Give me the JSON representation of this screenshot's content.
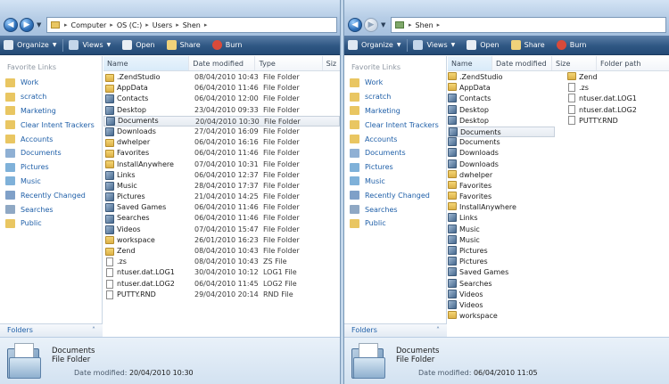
{
  "left": {
    "breadcrumb": [
      "Computer",
      "OS (C:)",
      "Users",
      "Shen"
    ],
    "toolbar": {
      "organize": "Organize",
      "views": "Views",
      "open": "Open",
      "share": "Share",
      "burn": "Burn"
    },
    "favorites_header": "Favorite Links",
    "favorites": [
      "Work",
      "scratch",
      "Marketing",
      "Clear Intent Trackers",
      "Accounts",
      "Documents",
      "Pictures",
      "Music",
      "Recently Changed",
      "Searches",
      "Public"
    ],
    "folders_label": "Folders",
    "columns": [
      "Name",
      "Date modified",
      "Type",
      "Siz"
    ],
    "rows": [
      {
        "name": ".ZendStudio",
        "date": "08/04/2010 10:43",
        "type": "File Folder",
        "icon": "folder"
      },
      {
        "name": "AppData",
        "date": "06/04/2010 11:46",
        "type": "File Folder",
        "icon": "folder"
      },
      {
        "name": "Contacts",
        "date": "06/04/2010 12:00",
        "type": "File Folder",
        "icon": "sys"
      },
      {
        "name": "Desktop",
        "date": "23/04/2010 09:33",
        "type": "File Folder",
        "icon": "sys"
      },
      {
        "name": "Documents",
        "date": "20/04/2010 10:30",
        "type": "File Folder",
        "icon": "sys",
        "selected": true
      },
      {
        "name": "Downloads",
        "date": "27/04/2010 16:09",
        "type": "File Folder",
        "icon": "sys"
      },
      {
        "name": "dwhelper",
        "date": "06/04/2010 16:16",
        "type": "File Folder",
        "icon": "folder"
      },
      {
        "name": "Favorites",
        "date": "06/04/2010 11:46",
        "type": "File Folder",
        "icon": "folder"
      },
      {
        "name": "InstallAnywhere",
        "date": "07/04/2010 10:31",
        "type": "File Folder",
        "icon": "folder"
      },
      {
        "name": "Links",
        "date": "06/04/2010 12:37",
        "type": "File Folder",
        "icon": "sys"
      },
      {
        "name": "Music",
        "date": "28/04/2010 17:37",
        "type": "File Folder",
        "icon": "sys"
      },
      {
        "name": "Pictures",
        "date": "21/04/2010 14:25",
        "type": "File Folder",
        "icon": "sys"
      },
      {
        "name": "Saved Games",
        "date": "06/04/2010 11:46",
        "type": "File Folder",
        "icon": "sys"
      },
      {
        "name": "Searches",
        "date": "06/04/2010 11:46",
        "type": "File Folder",
        "icon": "sys"
      },
      {
        "name": "Videos",
        "date": "07/04/2010 15:47",
        "type": "File Folder",
        "icon": "sys"
      },
      {
        "name": "workspace",
        "date": "26/01/2010 16:23",
        "type": "File Folder",
        "icon": "folder"
      },
      {
        "name": "Zend",
        "date": "08/04/2010 10:43",
        "type": "File Folder",
        "icon": "folder"
      },
      {
        "name": ".zs",
        "date": "08/04/2010 10:43",
        "type": "ZS File",
        "icon": "doc"
      },
      {
        "name": "ntuser.dat.LOG1",
        "date": "30/04/2010 10:12",
        "type": "LOG1 File",
        "icon": "doc"
      },
      {
        "name": "ntuser.dat.LOG2",
        "date": "06/04/2010 11:45",
        "type": "LOG2 File",
        "icon": "doc"
      },
      {
        "name": "PUTTY.RND",
        "date": "29/04/2010 20:14",
        "type": "RND File",
        "icon": "doc"
      }
    ],
    "details": {
      "name": "Documents",
      "type": "File Folder",
      "modified_label": "Date modified:",
      "modified_value": "20/04/2010 10:30"
    }
  },
  "right": {
    "breadcrumb": [
      "Shen"
    ],
    "toolbar": {
      "organize": "Organize",
      "views": "Views",
      "open": "Open",
      "share": "Share",
      "burn": "Burn"
    },
    "favorites_header": "Favorite Links",
    "favorites": [
      "Work",
      "scratch",
      "Marketing",
      "Clear Intent Trackers",
      "Accounts",
      "Documents",
      "Pictures",
      "Music",
      "Recently Changed",
      "Searches",
      "Public"
    ],
    "folders_label": "Folders",
    "columns": [
      "Name",
      "Date modified",
      "Size",
      "Folder path"
    ],
    "col1": [
      {
        "name": ".ZendStudio",
        "icon": "folder"
      },
      {
        "name": "AppData",
        "icon": "folder"
      },
      {
        "name": "Contacts",
        "icon": "sys"
      },
      {
        "name": "Desktop",
        "icon": "sys"
      },
      {
        "name": "Desktop",
        "icon": "sys"
      },
      {
        "name": "Documents",
        "icon": "sys",
        "selected": true
      },
      {
        "name": "Documents",
        "icon": "sys"
      },
      {
        "name": "Downloads",
        "icon": "sys"
      },
      {
        "name": "Downloads",
        "icon": "sys"
      },
      {
        "name": "dwhelper",
        "icon": "folder"
      },
      {
        "name": "Favorites",
        "icon": "folder"
      },
      {
        "name": "Favorites",
        "icon": "folder"
      },
      {
        "name": "InstallAnywhere",
        "icon": "folder"
      },
      {
        "name": "Links",
        "icon": "sys"
      },
      {
        "name": "Music",
        "icon": "sys"
      },
      {
        "name": "Music",
        "icon": "sys"
      },
      {
        "name": "Pictures",
        "icon": "sys"
      },
      {
        "name": "Pictures",
        "icon": "sys"
      },
      {
        "name": "Saved Games",
        "icon": "sys"
      },
      {
        "name": "Searches",
        "icon": "sys"
      },
      {
        "name": "Videos",
        "icon": "sys"
      },
      {
        "name": "Videos",
        "icon": "sys"
      },
      {
        "name": "workspace",
        "icon": "folder"
      }
    ],
    "col2": [
      {
        "name": "Zend",
        "icon": "folder"
      },
      {
        "name": ".zs",
        "icon": "doc"
      },
      {
        "name": "ntuser.dat.LOG1",
        "icon": "doc"
      },
      {
        "name": "ntuser.dat.LOG2",
        "icon": "doc"
      },
      {
        "name": "PUTTY.RND",
        "icon": "doc"
      }
    ],
    "details": {
      "name": "Documents",
      "type": "File Folder",
      "modified_label": "Date modified:",
      "modified_value": "06/04/2010 11:05"
    }
  },
  "colors": {
    "link": "#1f5fa8",
    "cmdbar": "#2f5784",
    "address_bar": "#b6cde6"
  },
  "icons": {
    "folder": "folder-icon",
    "system_folder": "system-folder-icon",
    "document": "document-icon"
  }
}
